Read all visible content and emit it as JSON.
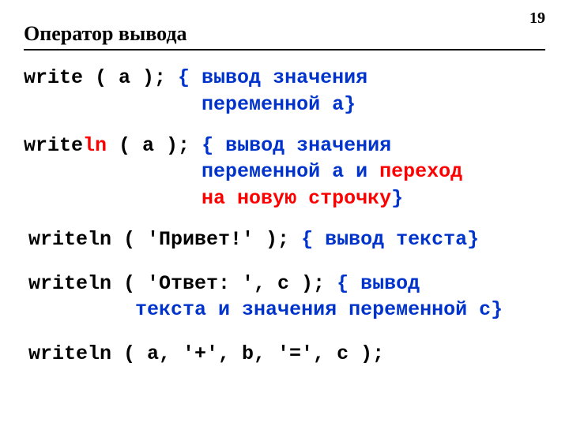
{
  "page_number": "19",
  "title": "Оператор вывода",
  "ex1": {
    "code": "write ( a );   ",
    "comment_l1": "{ вывод значения",
    "comment_l2_pad": "               ",
    "comment_l2": "переменной a}"
  },
  "ex2": {
    "code_pre": "write",
    "code_ln": "ln",
    "code_post": " ( a ); ",
    "comment_l1": "{ вывод значения",
    "pad": "               ",
    "comment_l2a": "переменной a и ",
    "comment_l2b": "переход",
    "comment_l3a": "на новую строчку",
    "comment_l3b": "}"
  },
  "ex3": {
    "code": "writeln ( 'Привет!' ); ",
    "comment": "{ вывод текста}"
  },
  "ex4": {
    "code": "writeln ( 'Ответ: ', c );   ",
    "comment_l1": "{ вывод",
    "pad": "         ",
    "comment_l2": "текста и значения переменной c}"
  },
  "ex5": {
    "code": "writeln ( a, '+', b, '=', c );"
  }
}
